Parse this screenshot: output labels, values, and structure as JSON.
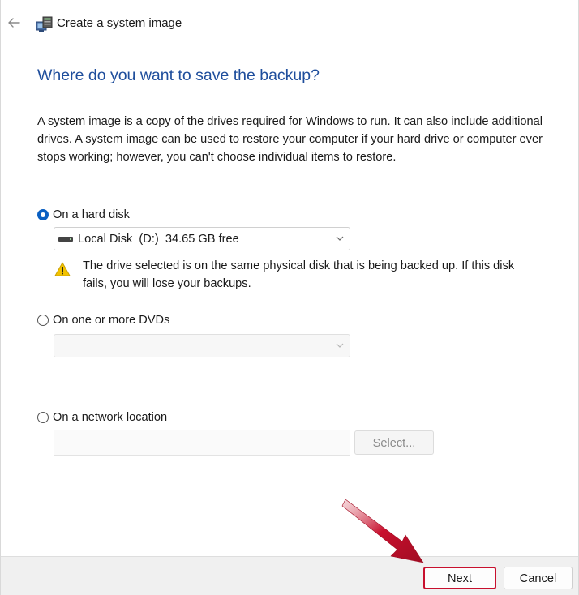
{
  "window": {
    "title": "Create a system image"
  },
  "page": {
    "heading": "Where do you want to save the backup?",
    "description": "A system image is a copy of the drives required for Windows to run. It can also include additional drives. A system image can be used to restore your computer if your hard drive or computer ever stops working; however, you can't choose individual items to restore."
  },
  "options": {
    "hard_disk": {
      "label": "On a hard disk",
      "selected": true,
      "drive_selected": "Local Disk  (D:)  34.65 GB free",
      "warning": "The drive selected is on the same physical disk that is being backed up. If this disk fails, you will lose your backups."
    },
    "dvd": {
      "label": "On one or more DVDs",
      "selected": false,
      "drive_selected": ""
    },
    "network": {
      "label": "On a network location",
      "selected": false,
      "path_value": "",
      "select_button_label": "Select..."
    }
  },
  "footer": {
    "next_label": "Next",
    "cancel_label": "Cancel"
  },
  "colors": {
    "heading": "#1f4e9c",
    "accent": "#0a5fc2",
    "highlight": "#c8102e",
    "warning": "#f2c200"
  }
}
